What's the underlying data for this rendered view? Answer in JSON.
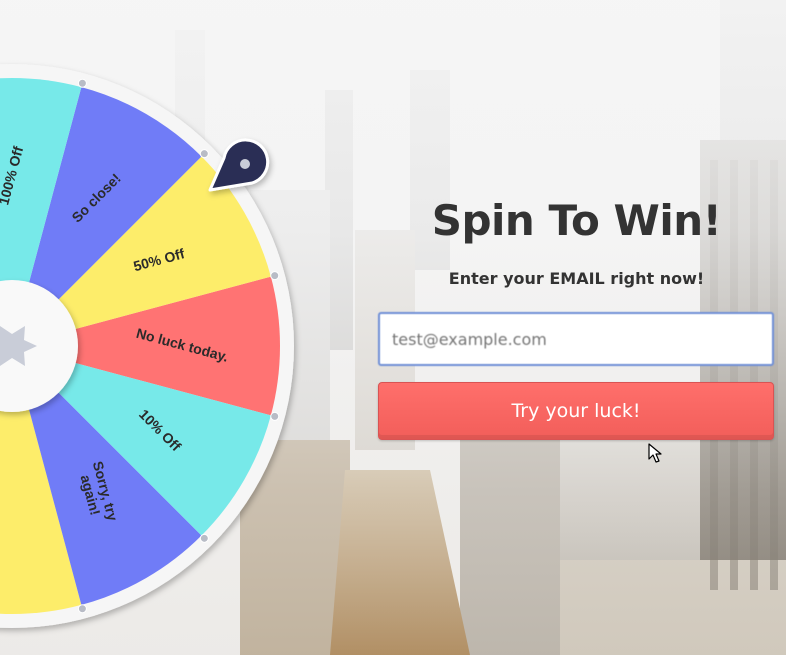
{
  "headline": "Spin To Win!",
  "subheadline": "Enter your EMAIL right now!",
  "email": {
    "value": "",
    "placeholder": "test@example.com"
  },
  "cta_label": "Try your luck!",
  "wheel": {
    "segments": [
      {
        "label": "No luck today.",
        "color": "#ff7373"
      },
      {
        "label": "50% Off",
        "color": "#fded6a"
      },
      {
        "label": "So close!",
        "color": "#707cf7"
      },
      {
        "label": "100% Off",
        "color": "#77e9e9"
      },
      {
        "label": "",
        "color": "#ff7373"
      },
      {
        "label": "",
        "color": "#fded6a"
      },
      {
        "label": "",
        "color": "#707cf7"
      },
      {
        "label": "",
        "color": "#77e9e9"
      },
      {
        "label": "",
        "color": "#ff7373"
      },
      {
        "label": "",
        "color": "#fded6a"
      },
      {
        "label": "Sorry, try again!",
        "color": "#707cf7"
      },
      {
        "label": "10% Off",
        "color": "#77e9e9"
      }
    ]
  },
  "colors": {
    "accent": "#f25e5a",
    "pointer": "#2b2f55",
    "text": "#333333",
    "input_border": "#6f8fd6"
  },
  "icons": {
    "pointer": "map-pin-icon",
    "hub": "star-icon",
    "cursor": "arrow-cursor-icon"
  }
}
